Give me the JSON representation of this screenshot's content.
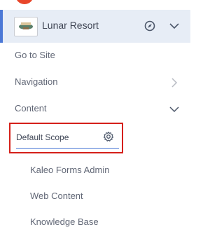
{
  "site": {
    "name": "Lunar Resort"
  },
  "menu": {
    "go_to_site": "Go to Site",
    "navigation": "Navigation",
    "content": "Content"
  },
  "scope": {
    "label": "Default Scope"
  },
  "content_items": [
    "Kaleo Forms Admin",
    "Web Content",
    "Knowledge Base"
  ],
  "colors": {
    "accent": "#4b78d6",
    "highlight_box": "#d5201a",
    "header_bg": "#e7edf6"
  },
  "icons": {
    "compass": "compass-icon",
    "chevron_down": "chevron-down-icon",
    "chevron_right": "chevron-right-icon",
    "gear": "gear-icon"
  }
}
